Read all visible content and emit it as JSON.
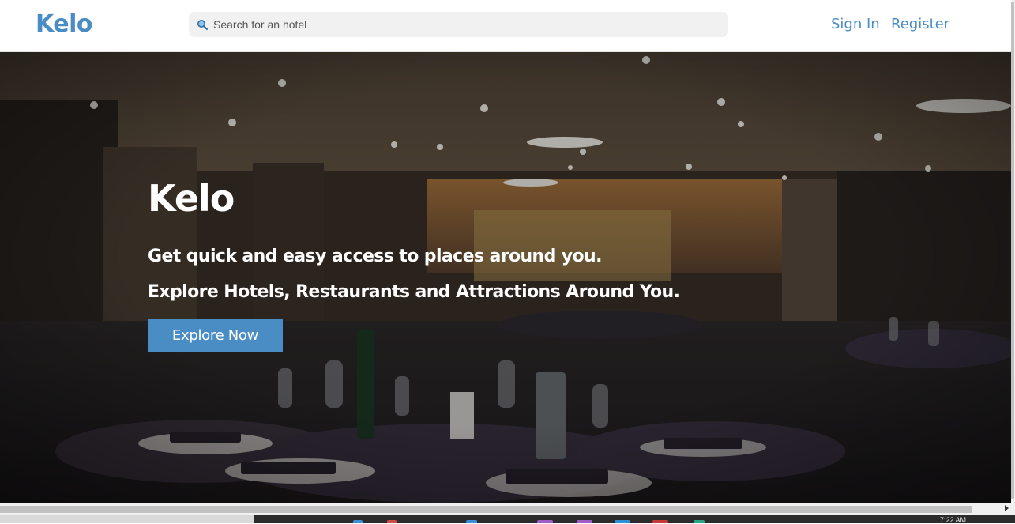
{
  "header": {
    "logo": "Kelo",
    "search": {
      "placeholder": "Search for an hotel",
      "value": ""
    },
    "nav": {
      "sign_in": "Sign In",
      "register": "Register"
    }
  },
  "hero": {
    "title": "Kelo",
    "tagline1": "Get quick and easy access to places around you.",
    "tagline2": "Explore Hotels, Restaurants and Attractions Around You.",
    "cta_label": "Explore Now",
    "background": "restaurant-dining-room-photo"
  },
  "taskbar": {
    "clock": "7:22 AM"
  },
  "colors": {
    "brand": "#4a8dc4",
    "header_bg": "#ffffff",
    "search_bg": "#f1f1f1",
    "hero_text": "#ffffff",
    "taskbar": "#2b2b2b"
  },
  "icons": [
    "search-icon",
    "scroll-right-arrow-icon"
  ]
}
